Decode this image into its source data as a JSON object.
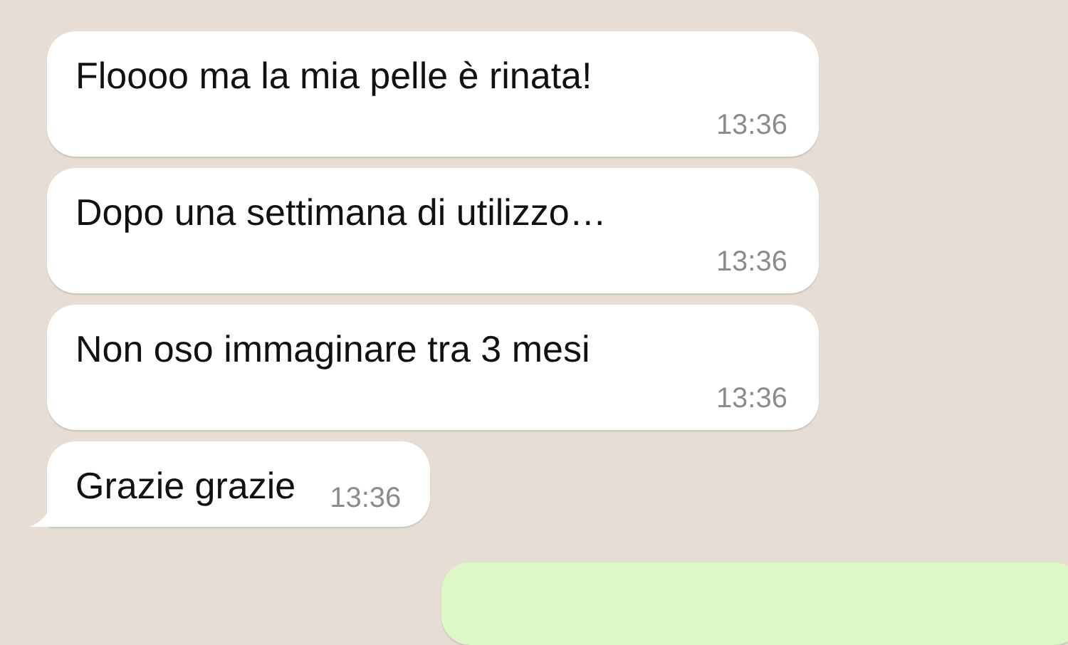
{
  "messages": [
    {
      "kind": "wide",
      "text": "Floooo ma la mia pelle è rinata!",
      "time": "13:36",
      "tail": false
    },
    {
      "kind": "wide",
      "text": "Dopo una settimana di utilizzo…",
      "time": "13:36",
      "tail": false
    },
    {
      "kind": "wide",
      "text": "Non oso immaginare tra 3 mesi",
      "time": "13:36",
      "tail": false
    },
    {
      "kind": "compact",
      "text": "Grazie grazie",
      "time": "13:36",
      "tail": true
    },
    {
      "kind": "sent",
      "tail": false
    }
  ]
}
